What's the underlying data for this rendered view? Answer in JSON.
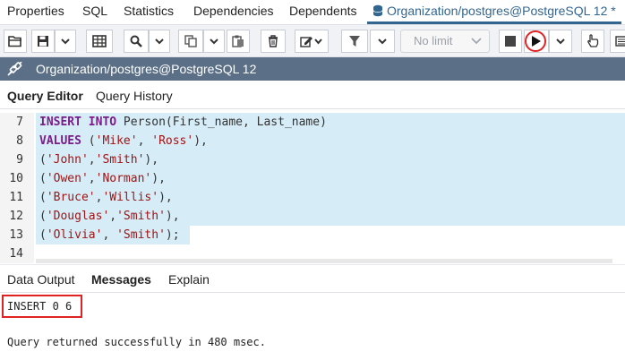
{
  "top_tabs": [
    {
      "label": "Properties"
    },
    {
      "label": "SQL"
    },
    {
      "label": "Statistics"
    },
    {
      "label": "Dependencies"
    },
    {
      "label": "Dependents"
    },
    {
      "label": "Organization/postgres@PostgreSQL 12 *",
      "active": true
    }
  ],
  "toolbar": {
    "limit_select_value": "No limit",
    "icons": [
      "folder-open-icon",
      "save-icon",
      "table-icon",
      "search-icon",
      "copy-icon",
      "paste-icon",
      "trash-icon",
      "edit-icon",
      "filter-icon",
      "stop-icon",
      "execute-icon",
      "hand-icon",
      "list-icon"
    ]
  },
  "connection": {
    "label": "Organization/postgres@PostgreSQL 12"
  },
  "editor_tabs": [
    {
      "label": "Query Editor",
      "active": true
    },
    {
      "label": "Query History"
    }
  ],
  "code_lines": [
    {
      "number": "7",
      "text": "INSERT INTO Person(First_name, Last_name)"
    },
    {
      "number": "8",
      "text": "VALUES ('Mike', 'Ross'),"
    },
    {
      "number": "9",
      "text": "('John','Smith'),"
    },
    {
      "number": "10",
      "text": "('Owen','Norman'),"
    },
    {
      "number": "11",
      "text": "('Bruce','Willis'),"
    },
    {
      "number": "12",
      "text": "('Douglas','Smith'),"
    },
    {
      "number": "13",
      "text": "('Olivia', 'Smith');"
    },
    {
      "number": "14",
      "text": ""
    }
  ],
  "output_tabs": [
    {
      "label": "Data Output"
    },
    {
      "label": "Messages",
      "active": true
    },
    {
      "label": "Explain"
    }
  ],
  "messages": {
    "result": "INSERT 0 6",
    "status": "Query returned successfully in 480 msec."
  },
  "colors": {
    "accent": "#326690",
    "connection_bar": "#5b6f86",
    "selection": "#d6ecf7",
    "highlight_red": "#e12222",
    "keyword": "#7a1d8a",
    "string": "#a01414"
  }
}
